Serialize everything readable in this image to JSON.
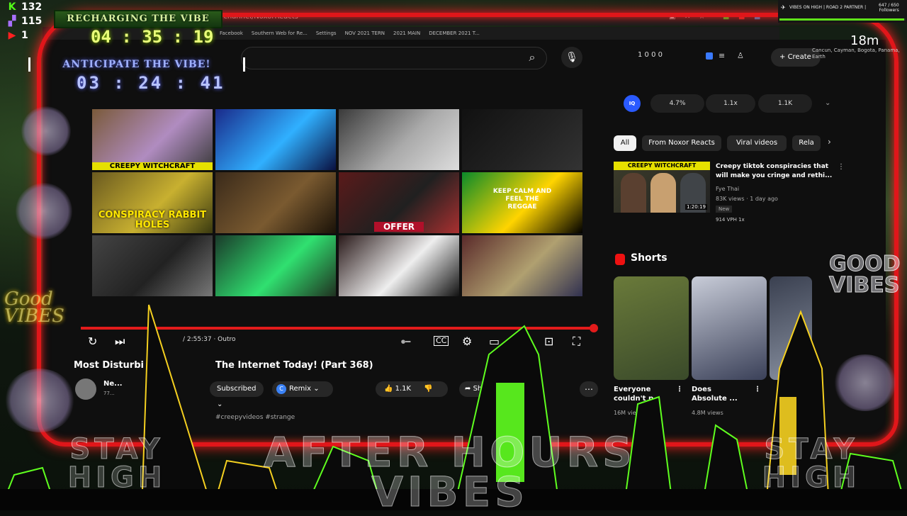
{
  "overlay": {
    "kick_count": "132",
    "twitch_count": "115",
    "youtube_count": "1",
    "recharging_label": "RECHARGING THE VIBE",
    "recharging_time": "04 : 35 : 19",
    "anticipate_label": "ANTICIPATE THE VIBE!",
    "anticipate_time": "03 : 24 : 41",
    "top_right_title": "VIBES ON HIGH | ROAD 2 PARTNER |",
    "followers_count": "647 / 650",
    "followers_label": "Followers",
    "time_ago": "18m",
    "location_text": "Cancun, Cayman, Bogota, Panama, Earth",
    "good_vibes_left": "Good VIBES",
    "good_vibes_right": "GOOD VIBES",
    "stay_high": "STAY HIGH",
    "after_hours": "AFTER HOURS VIBES"
  },
  "browser": {
    "url": "/channel/NoxorReacts",
    "bookmarks": [
      "Facebook",
      "Southern Web for Re...",
      "Settings",
      "NOV 2021 TERN",
      "2021 MAIN",
      "DECEMBER 2021 T..."
    ]
  },
  "youtube": {
    "create_label": "Create",
    "top_stats": "1 0 0 0",
    "thumbnails": [
      {
        "label": "CREEPY WITCHCRAFT",
        "colors": [
          "#7a5a3a",
          "#b08cc0",
          "#3a3a3a"
        ]
      },
      {
        "label": "",
        "colors": [
          "#1a2a8a",
          "#30b0ff",
          "#0a1040"
        ]
      },
      {
        "label": "",
        "colors": [
          "#3a3a3a",
          "#aaa",
          "#ddd"
        ]
      },
      {
        "label": "",
        "colors": [
          "#111",
          "#222",
          "#333"
        ]
      },
      {
        "label": "CONSPIRACY RABBIT HOLES",
        "colors": [
          "#6a5a20",
          "#c8b030",
          "#3a3a10"
        ]
      },
      {
        "label": "",
        "colors": [
          "#3a2a1a",
          "#7a5a30",
          "#1a1208"
        ]
      },
      {
        "label": "OFFER",
        "colors": [
          "#5a1a1a",
          "#202020",
          "#aa3030"
        ]
      },
      {
        "label": "KEEP CALM AND FEEL THE REGGAE",
        "colors": [
          "#0a8a2a",
          "#ffd400",
          "#000"
        ]
      },
      {
        "label": "",
        "colors": [
          "#444",
          "#222",
          "#777"
        ]
      },
      {
        "label": "",
        "colors": [
          "#1a3a2a",
          "#30e070",
          "#203020"
        ]
      },
      {
        "label": "",
        "colors": [
          "#2a1a1a",
          "#eee",
          "#111"
        ]
      },
      {
        "label": "",
        "colors": [
          "#5a2a2a",
          "#b0a070",
          "#303050"
        ]
      }
    ],
    "player": {
      "time": "/ 2:55:37 · Outro",
      "title_part1": "Most Disturbi",
      "title_part2": "The Internet Today! (Part 368)",
      "channel_name": "Ne...",
      "channel_subs": "77...",
      "subscribed_label": "Subscribed",
      "remix_label": "Remix",
      "like_count": "1.1K",
      "share_label": "Share",
      "description": "#creepyvideos #strange"
    },
    "stats_pills": [
      "4.7%",
      "1.1x",
      "1.1K"
    ],
    "filter_chips": [
      "All",
      "From Noxor Reacts",
      "Viral videos",
      "Rela"
    ],
    "recommended": {
      "thumb_label": "CREEPY WITCHCRAFT",
      "duration": "1:20:19",
      "title": "Creepy tiktok conspiracies that will make you cringe and rethi...",
      "channel": "Fye Thai",
      "meta": "83K views · 1 day ago",
      "new_badge": "New",
      "extra": "914 VPH   1x"
    },
    "shorts_heading": "Shorts",
    "shorts": [
      {
        "title": "Everyone couldn't p",
        "views": "16M views",
        "colors": [
          "#6a7a3a",
          "#3a4a2a"
        ]
      },
      {
        "title": "Does Absolute ...",
        "views": "4.8M views",
        "colors": [
          "#c8ccd8",
          "#3a4058"
        ]
      },
      {
        "title": "",
        "views": "",
        "colors": [
          "#3a4050",
          "#8890a0"
        ]
      }
    ]
  }
}
